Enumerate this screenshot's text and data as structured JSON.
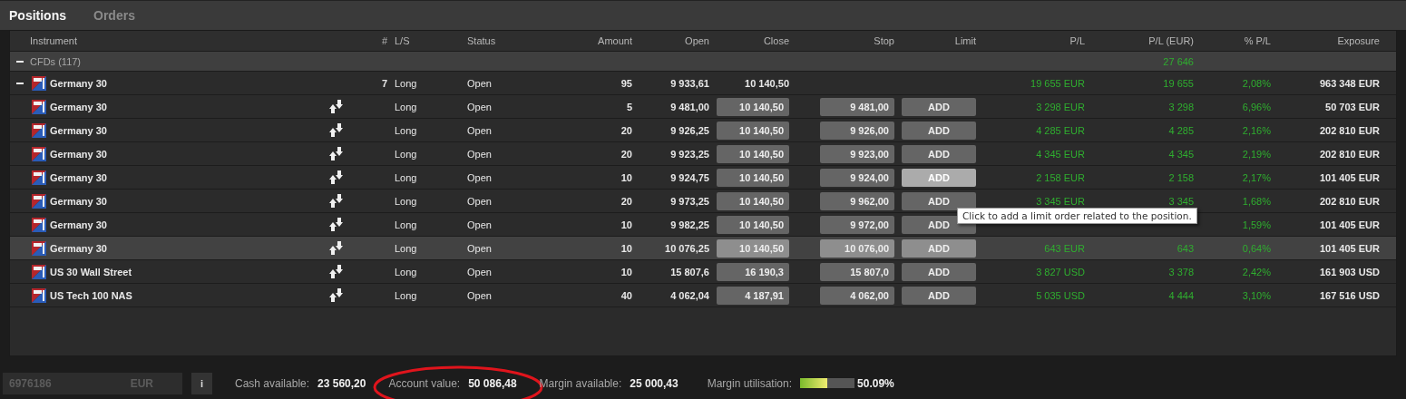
{
  "tabs": [
    {
      "label": "Positions",
      "selected": true
    },
    {
      "label": "Orders",
      "selected": false
    }
  ],
  "table": {
    "columns": [
      "Instrument",
      "#",
      "L/S",
      "Status",
      "Amount",
      "Open",
      "Close",
      "Stop",
      "Limit",
      "P/L",
      "P/L (EUR)",
      "% P/L",
      "Exposure"
    ],
    "group": {
      "label": "CFDs (117)",
      "expanded": true,
      "pl_eur": "27 646"
    },
    "parent": {
      "expanded": true,
      "instrument": "Germany 30",
      "count": "7",
      "ls": "Long",
      "status": "Open",
      "amount": "95",
      "open": "9 933,61",
      "close": "10 140,50",
      "pl": "19 655 EUR",
      "pl_eur": "19 655",
      "pct": "2,08%",
      "exposure": "963 348 EUR"
    },
    "rows": [
      {
        "instrument": "Germany 30",
        "ls": "Long",
        "status": "Open",
        "amount": "5",
        "open": "9 481,00",
        "close": "10 140,50",
        "stop": "9 481,00",
        "limit": "ADD",
        "limit_hover": false,
        "pl": "3 298 EUR",
        "pl_eur": "3 298",
        "pct": "6,96%",
        "exposure": "50 703 EUR",
        "selected": false
      },
      {
        "instrument": "Germany 30",
        "ls": "Long",
        "status": "Open",
        "amount": "20",
        "open": "9 926,25",
        "close": "10 140,50",
        "stop": "9 926,00",
        "limit": "ADD",
        "limit_hover": false,
        "pl": "4 285 EUR",
        "pl_eur": "4 285",
        "pct": "2,16%",
        "exposure": "202 810 EUR",
        "selected": false
      },
      {
        "instrument": "Germany 30",
        "ls": "Long",
        "status": "Open",
        "amount": "20",
        "open": "9 923,25",
        "close": "10 140,50",
        "stop": "9 923,00",
        "limit": "ADD",
        "limit_hover": false,
        "pl": "4 345 EUR",
        "pl_eur": "4 345",
        "pct": "2,19%",
        "exposure": "202 810 EUR",
        "selected": false
      },
      {
        "instrument": "Germany 30",
        "ls": "Long",
        "status": "Open",
        "amount": "10",
        "open": "9 924,75",
        "close": "10 140,50",
        "stop": "9 924,00",
        "limit": "ADD",
        "limit_hover": true,
        "pl": "2 158 EUR",
        "pl_eur": "2 158",
        "pct": "2,17%",
        "exposure": "101 405 EUR",
        "selected": false
      },
      {
        "instrument": "Germany 30",
        "ls": "Long",
        "status": "Open",
        "amount": "20",
        "open": "9 973,25",
        "close": "10 140,50",
        "stop": "9 962,00",
        "limit": "ADD",
        "limit_hover": false,
        "pl": "3 345 EUR",
        "pl_eur": "3 345",
        "pct": "1,68%",
        "exposure": "202 810 EUR",
        "selected": false
      },
      {
        "instrument": "Germany 30",
        "ls": "Long",
        "status": "Open",
        "amount": "10",
        "open": "9 982,25",
        "close": "10 140,50",
        "stop": "9 972,00",
        "limit": "ADD",
        "limit_hover": false,
        "pct": "1,59%",
        "exposure": "101 405 EUR",
        "selected": false
      },
      {
        "instrument": "Germany 30",
        "ls": "Long",
        "status": "Open",
        "amount": "10",
        "open": "10 076,25",
        "close": "10 140,50",
        "stop": "10 076,00",
        "limit": "ADD",
        "limit_hover": false,
        "pl": "643 EUR",
        "pl_eur": "643",
        "pct": "0,64%",
        "exposure": "101 405 EUR",
        "selected": true
      },
      {
        "instrument": "US 30 Wall Street",
        "ls": "Long",
        "status": "Open",
        "amount": "10",
        "open": "15 807,6",
        "close": "16 190,3",
        "stop": "15 807,0",
        "limit": "ADD",
        "limit_hover": false,
        "pl": "3 827 USD",
        "pl_eur": "3 378",
        "pct": "2,42%",
        "exposure": "161 903 USD",
        "selected": false
      },
      {
        "instrument": "US Tech 100 NAS",
        "ls": "Long",
        "status": "Open",
        "amount": "40",
        "open": "4 062,04",
        "close": "4 187,91",
        "stop": "4 062,00",
        "limit": "ADD",
        "limit_hover": false,
        "pl": "5 035 USD",
        "pl_eur": "4 444",
        "pct": "3,10%",
        "exposure": "167 516 USD",
        "selected": false
      }
    ]
  },
  "tooltip": {
    "text": "Click to add a limit order related to the position."
  },
  "footer": {
    "account": "6976186",
    "currency": "EUR",
    "info_button": "i",
    "items": [
      {
        "label": "Cash available:",
        "value": "23 560,20",
        "circled": false
      },
      {
        "label": "Account value:",
        "value": "50 086,48",
        "circled": true
      },
      {
        "label": "Margin available:",
        "value": "25 000,43",
        "circled": false
      }
    ],
    "margin": {
      "label": "Margin utilisation:",
      "level": 0.5,
      "reading": "50.09%"
    }
  }
}
